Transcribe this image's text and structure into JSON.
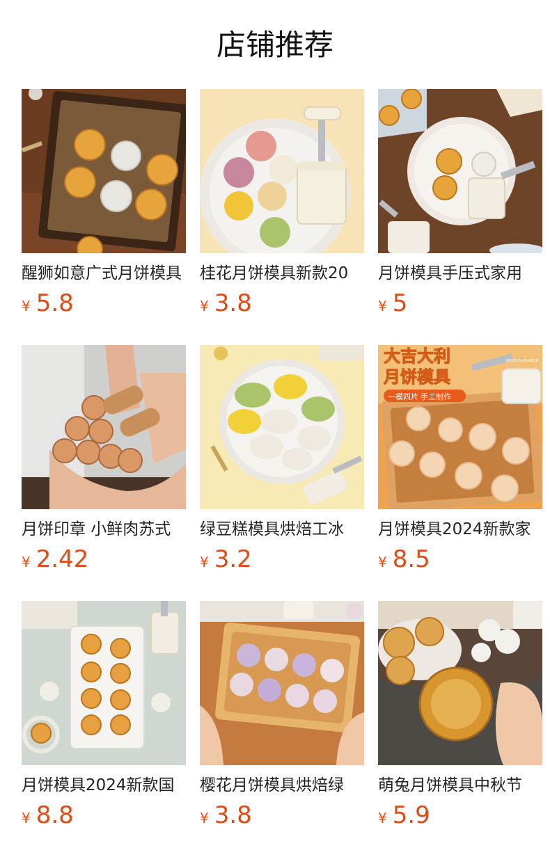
{
  "section": {
    "title": "店铺推荐"
  },
  "currency": "¥",
  "products": [
    {
      "name": "醒狮如意广式月饼模具",
      "price": "5.8",
      "image": "lion-mooncake-tray-photo"
    },
    {
      "name": "桂花月饼模具新款20",
      "price": "3.8",
      "image": "osmanthus-mooncake-plate-photo"
    },
    {
      "name": "月饼模具手压式家用",
      "price": "5",
      "image": "hand-press-mooncake-plate-photo"
    },
    {
      "name": "月饼印章 小鲜肉苏式",
      "price": "2.42",
      "image": "mooncake-stamps-in-hands-photo"
    },
    {
      "name": "绿豆糕模具烘焙工冰",
      "price": "3.2",
      "image": "mung-bean-cake-plate-photo"
    },
    {
      "name": "月饼模具2024新款家",
      "price": "8.5",
      "image": "daji-dali-mooncake-tray-photo",
      "image_text": {
        "line1": "大吉大利",
        "line2": "月饼模具",
        "tag": "一模四片 手工制作",
        "corner": "MOON CAKE MOLD"
      }
    },
    {
      "name": "月饼模具2024新款国",
      "price": "8.8",
      "image": "mooncakes-on-long-plate-photo"
    },
    {
      "name": "樱花月饼模具烘焙绿",
      "price": "3.8",
      "image": "sakura-mooncake-tray-in-hands-photo"
    },
    {
      "name": "萌兔月饼模具中秋节",
      "price": "5.9",
      "image": "rabbit-mooncake-in-hand-photo"
    }
  ]
}
